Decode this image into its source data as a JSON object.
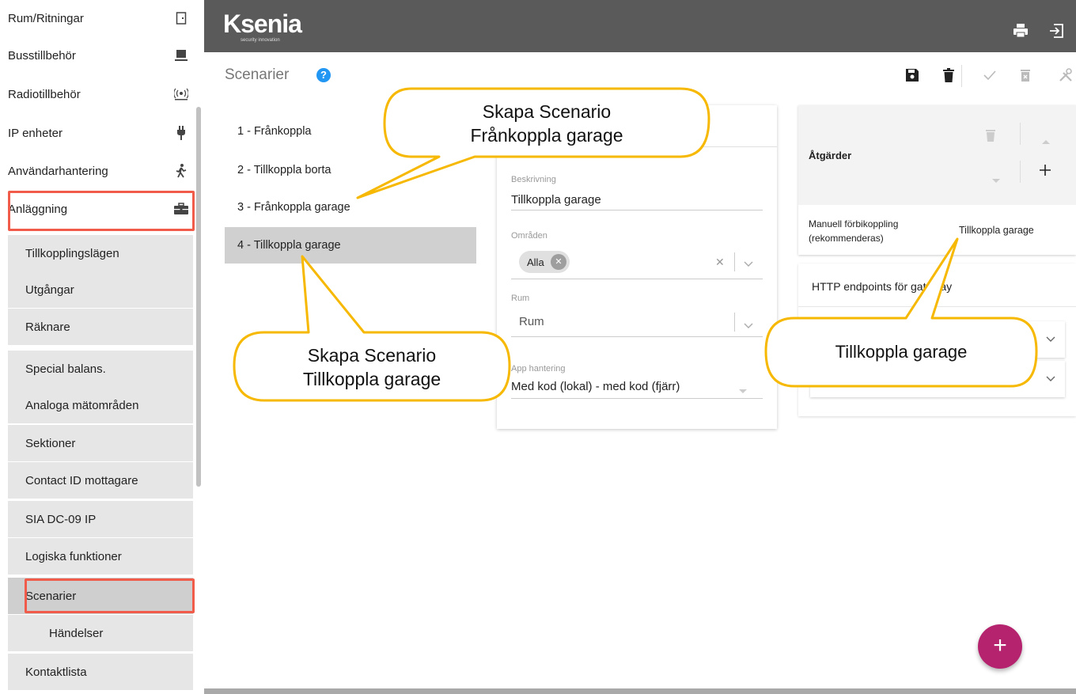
{
  "app": {
    "logo": "Ksenia",
    "logo_tagline": "security innovation"
  },
  "sidebar": {
    "items": [
      {
        "label": "Rum/Ritningar",
        "icon": "door-icon"
      },
      {
        "label": "Busstillbehör",
        "icon": "monitor-icon"
      },
      {
        "label": "Radiotillbehör",
        "icon": "radio-icon"
      },
      {
        "label": "IP enheter",
        "icon": "plug-icon"
      },
      {
        "label": "Användarhantering",
        "icon": "walking-person-icon"
      },
      {
        "label": "Anläggning",
        "icon": "briefcase-icon"
      }
    ],
    "children": [
      "Tillkopplingslägen",
      "Utgångar",
      "Räknare",
      "Special balans.",
      "Analoga mätområden",
      "Sektioner",
      "Contact ID mottagare",
      "SIA DC-09 IP",
      "Logiska funktioner",
      "Scenarier",
      "Händelser",
      "Kontaktlista"
    ],
    "selected": "Scenarier"
  },
  "page": {
    "title": "Scenarier",
    "help": "?"
  },
  "scenarios": [
    "1 - Frånkoppla",
    "2 - Tillkoppla borta",
    "3 - Frånkoppla garage",
    "4 - Tillkoppla garage"
  ],
  "form": {
    "description_label": "Beskrivning",
    "description_value": "Tillkoppla garage",
    "areas_label": "Områden",
    "areas_chip": "Alla",
    "rooms_label": "Rum",
    "rooms_placeholder": "Rum",
    "app_label": "App hantering",
    "app_value": "Med kod (lokal) - med kod (fjärr)"
  },
  "actions": {
    "title": "Åtgärder",
    "row_left": "Manuell förbikoppling (rekommenderas)",
    "row_right": "Tillkoppla garage"
  },
  "http": {
    "title": "HTTP endpoints för gateway"
  },
  "callouts": {
    "top": [
      "Skapa Scenario",
      "Frånkoppla garage"
    ],
    "left": [
      "Skapa Scenario",
      "Tillkoppla garage"
    ],
    "right": "Tillkoppla garage"
  },
  "fab": "+",
  "colors": {
    "accent": "#b5236f",
    "highlight": "#f15c4a",
    "callout_border": "#f6b800",
    "topbar": "#5a5a5a"
  }
}
